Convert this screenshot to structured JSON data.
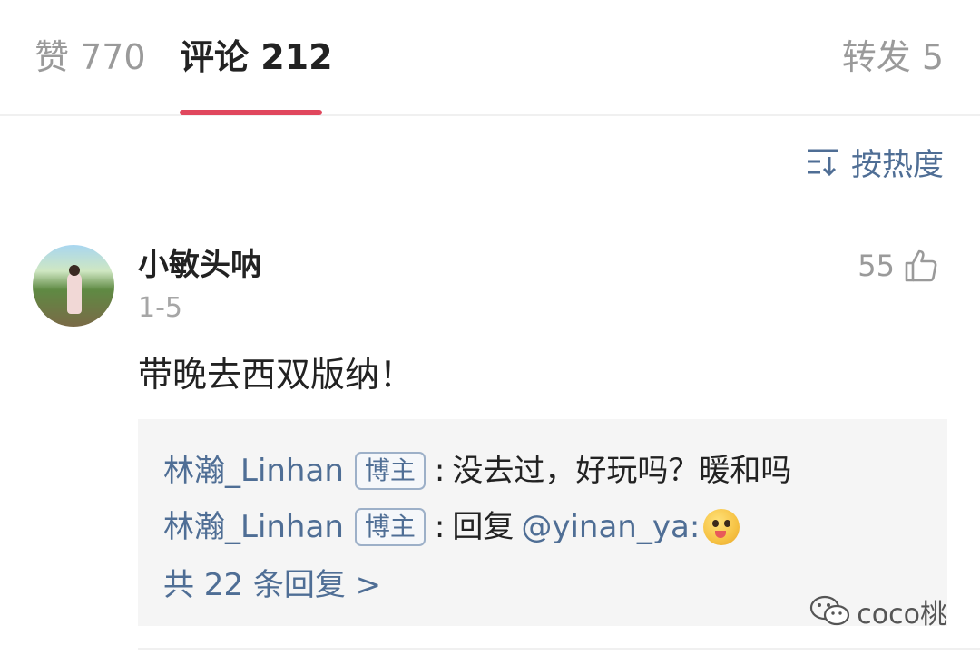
{
  "tabs": {
    "likes": "赞 770",
    "comments": "评论 212",
    "shares": "转发 5"
  },
  "sort": {
    "label": "按热度",
    "icon": "sort-icon"
  },
  "comment": {
    "username": "小敏头呐",
    "date": "1-5",
    "like_count": "55",
    "text": "带晚去西双版纳！",
    "replies": [
      {
        "name": "林瀚_Linhan",
        "badge": "博主",
        "colon": ":",
        "text": "没去过，好玩吗？暖和吗"
      },
      {
        "name": "林瀚_Linhan",
        "badge": "博主",
        "colon": ":",
        "text": "回复",
        "mention": "@yinan_ya:",
        "emoji": "tongue-out-face-emoji"
      }
    ],
    "more_replies": "共 22 条回复 >"
  },
  "watermark": {
    "text": "coco桃",
    "icon": "wechat-icon"
  },
  "colors": {
    "accent": "#e0475d",
    "link": "#4f6e95",
    "muted": "#9a9a9a",
    "reply_bg": "#f5f5f5"
  }
}
